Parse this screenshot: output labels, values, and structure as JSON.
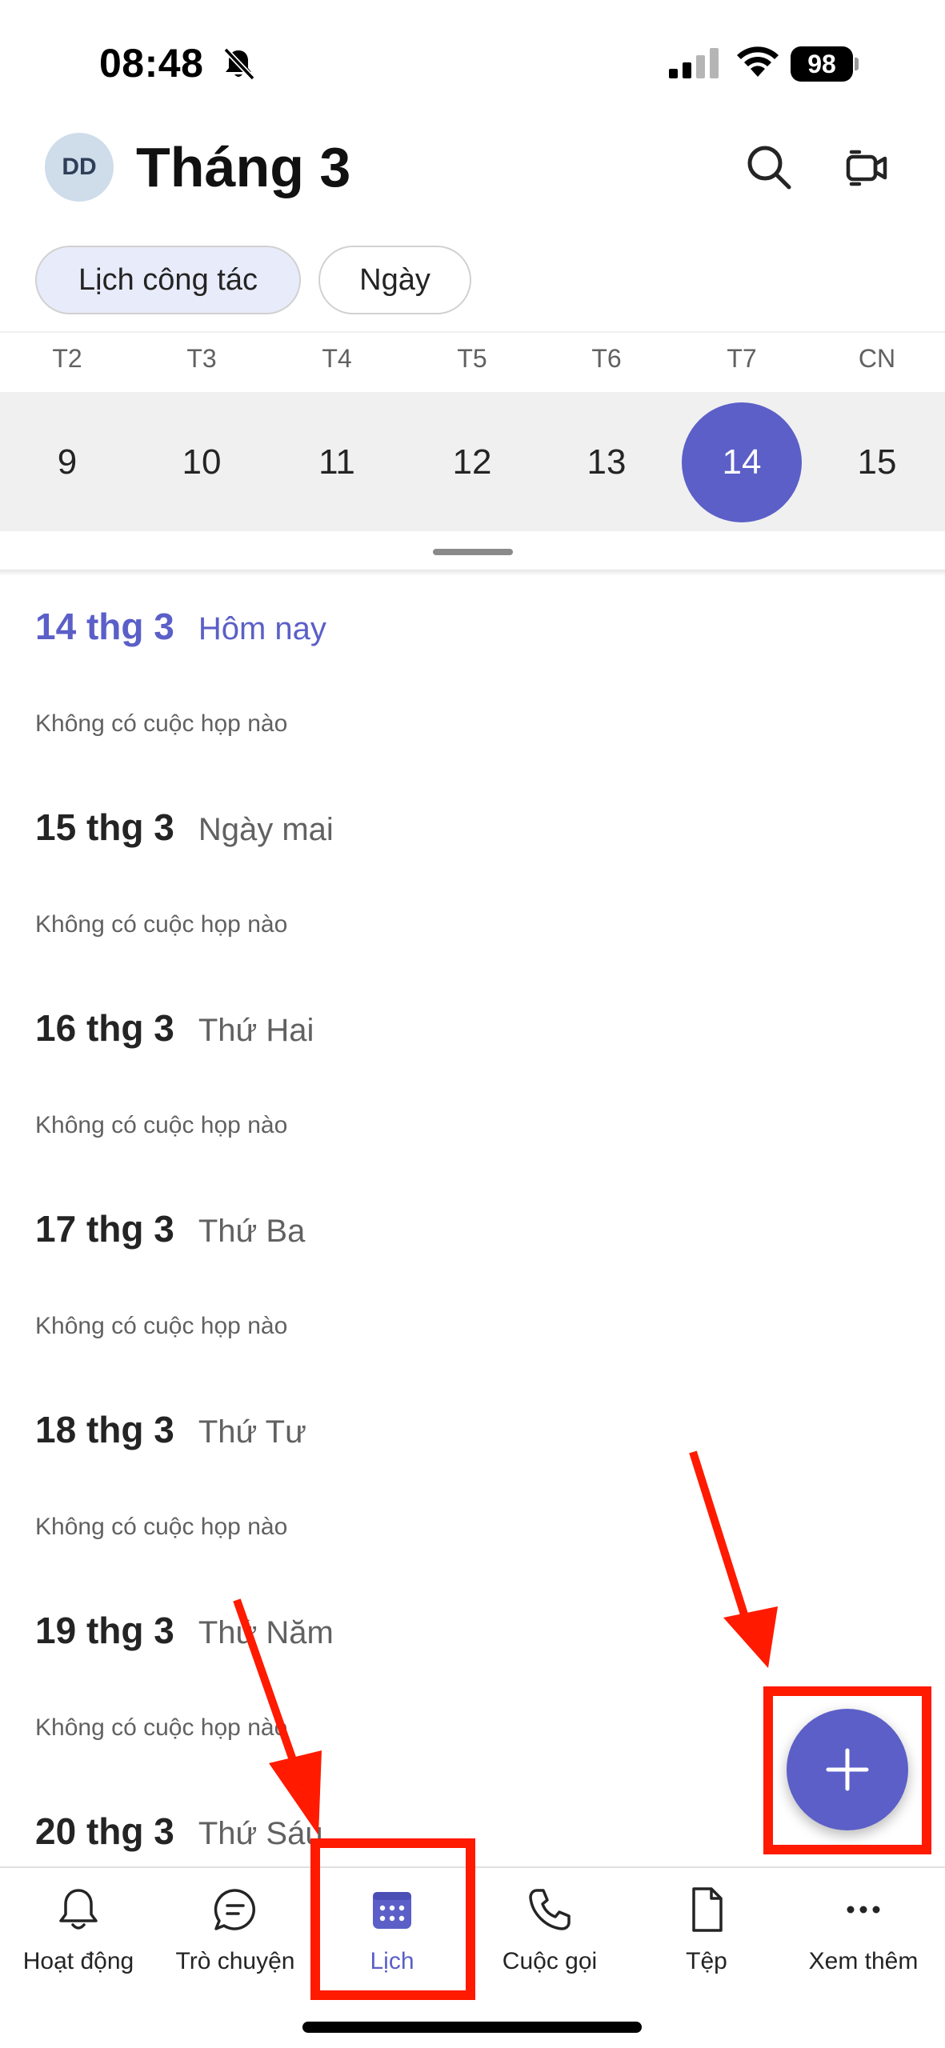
{
  "status_bar": {
    "time": "08:48",
    "battery": "98"
  },
  "header": {
    "avatar_initials": "DD",
    "title": "Tháng 3"
  },
  "view_pills": [
    {
      "label": "Lịch công tác",
      "selected": true
    },
    {
      "label": "Ngày",
      "selected": false
    }
  ],
  "week": {
    "labels": [
      "T2",
      "T3",
      "T4",
      "T5",
      "T6",
      "T7",
      "CN"
    ],
    "days": [
      "9",
      "10",
      "11",
      "12",
      "13",
      "14",
      "15"
    ],
    "selected_index": 5
  },
  "agenda": [
    {
      "date": "14 thg 3",
      "relative": "Hôm nay",
      "note": "Không có cuộc họp nào",
      "today": true
    },
    {
      "date": "15 thg 3",
      "relative": "Ngày mai",
      "note": "Không có cuộc họp nào"
    },
    {
      "date": "16 thg 3",
      "relative": "Thứ Hai",
      "note": "Không có cuộc họp nào"
    },
    {
      "date": "17 thg 3",
      "relative": "Thứ Ba",
      "note": "Không có cuộc họp nào"
    },
    {
      "date": "18 thg 3",
      "relative": "Thứ Tư",
      "note": "Không có cuộc họp nào"
    },
    {
      "date": "19 thg 3",
      "relative": "Thứ Năm",
      "note": "Không có cuộc họp nào"
    },
    {
      "date": "20 thg 3",
      "relative": "Thứ Sáu"
    }
  ],
  "bottom_nav": [
    {
      "label": "Hoạt động",
      "icon": "bell-icon"
    },
    {
      "label": "Trò chuyện",
      "icon": "chat-icon"
    },
    {
      "label": "Lịch",
      "icon": "calendar-icon",
      "active": true
    },
    {
      "label": "Cuộc gọi",
      "icon": "phone-icon"
    },
    {
      "label": "Tệp",
      "icon": "file-icon"
    },
    {
      "label": "Xem thêm",
      "icon": "more-icon"
    }
  ],
  "fab": {
    "icon": "plus-icon"
  },
  "colors": {
    "accent": "#5b5fc7",
    "annotation": "#ff1a00"
  }
}
